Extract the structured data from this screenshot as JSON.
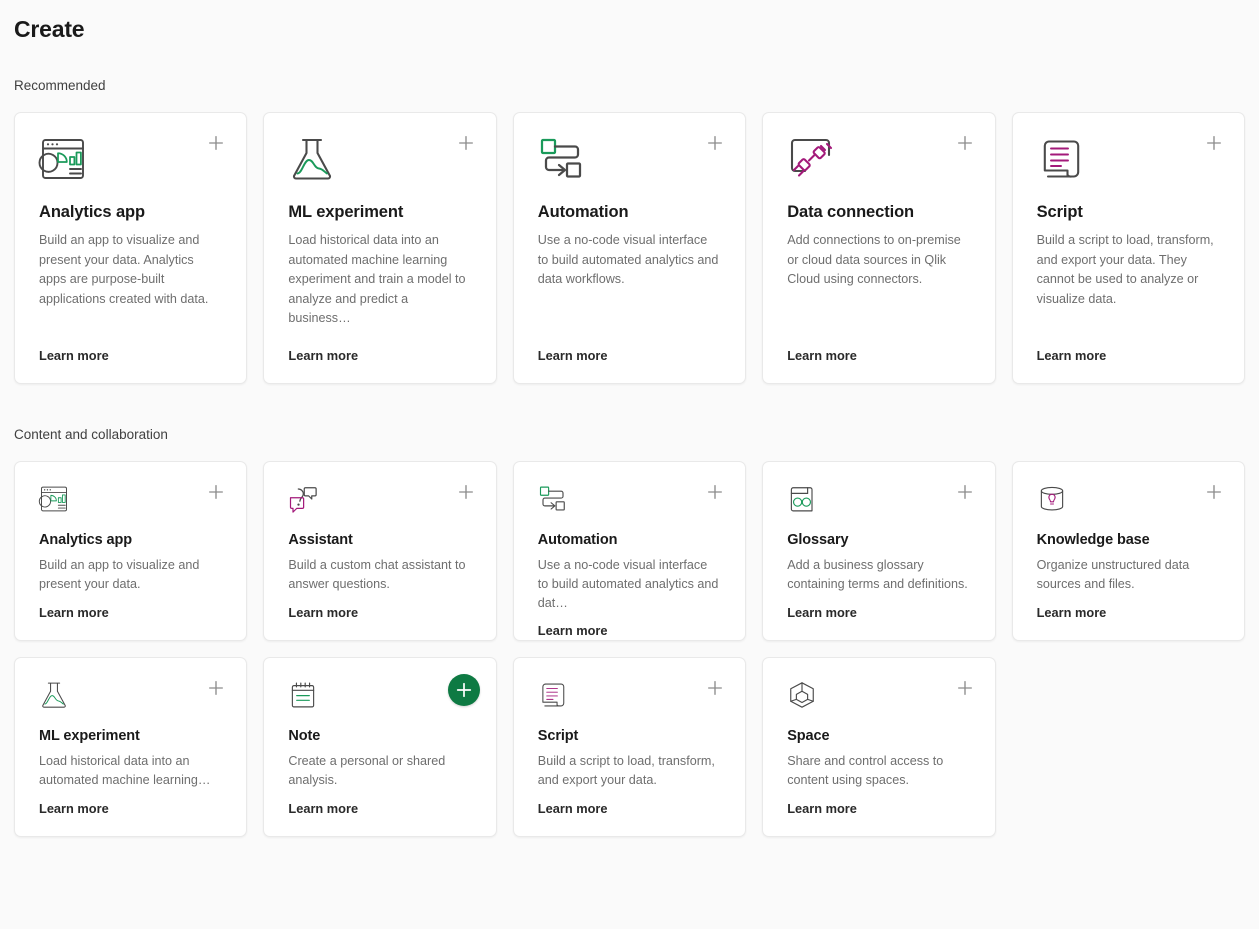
{
  "page": {
    "title": "Create"
  },
  "sections": [
    {
      "id": "recommended",
      "title": "Recommended",
      "cards": [
        {
          "icon": "analytics-app-icon",
          "title": "Analytics app",
          "description": "Build an app to visualize and present your data. Analytics apps are purpose-built applications created with data.",
          "link": "Learn more",
          "add_label": "+",
          "highlighted": false
        },
        {
          "icon": "ml-experiment-flask-icon",
          "title": "ML experiment",
          "description": "Load historical data into an automated machine learning experiment and train a model to analyze and predict a business…",
          "link": "Learn more",
          "add_label": "+",
          "highlighted": false
        },
        {
          "icon": "automation-flow-icon",
          "title": "Automation",
          "description": "Use a no-code visual interface to build automated analytics and data workflows.",
          "link": "Learn more",
          "add_label": "+",
          "highlighted": false
        },
        {
          "icon": "data-connection-plug-icon",
          "title": "Data connection",
          "description": "Add connections to on-premise or cloud data sources in Qlik Cloud using connectors.",
          "link": "Learn more",
          "add_label": "+",
          "highlighted": false
        },
        {
          "icon": "script-scroll-icon",
          "title": "Script",
          "description": "Build a script to load, transform, and export your data. They cannot be used to analyze or visualize data.",
          "link": "Learn more",
          "add_label": "+",
          "highlighted": false
        }
      ]
    },
    {
      "id": "content-and-collaboration",
      "title": "Content and collaboration",
      "cards_row1": [
        {
          "icon": "analytics-app-icon",
          "title": "Analytics app",
          "description": "Build an app to visualize and present your data.",
          "link": "Learn more",
          "add_label": "+",
          "highlighted": false
        },
        {
          "icon": "assistant-chat-icon",
          "title": "Assistant",
          "description": "Build a custom chat assistant to answer questions.",
          "link": "Learn more",
          "add_label": "+",
          "highlighted": false
        },
        {
          "icon": "automation-flow-icon",
          "title": "Automation",
          "description": "Use a no-code visual interface to build automated analytics and dat…",
          "link": "Learn more",
          "add_label": "+",
          "highlighted": false
        },
        {
          "icon": "glossary-book-icon",
          "title": "Glossary",
          "description": "Add a business glossary containing terms and definitions.",
          "link": "Learn more",
          "add_label": "+",
          "highlighted": false
        },
        {
          "icon": "knowledge-base-icon",
          "title": "Knowledge base",
          "description": "Organize unstructured data sources and files.",
          "link": "Learn more",
          "add_label": "+",
          "highlighted": false
        }
      ],
      "cards_row2": [
        {
          "icon": "ml-experiment-flask-icon",
          "title": "ML experiment",
          "description": "Load historical data into an automated machine learning…",
          "link": "Learn more",
          "add_label": "+",
          "highlighted": false
        },
        {
          "icon": "note-icon",
          "title": "Note",
          "description": "Create a personal or shared analysis.",
          "link": "Learn more",
          "add_label": "+",
          "highlighted": true
        },
        {
          "icon": "script-scroll-icon",
          "title": "Script",
          "description": "Build a script to load, transform, and export your data.",
          "link": "Learn more",
          "add_label": "+",
          "highlighted": false
        },
        {
          "icon": "space-cube-icon",
          "title": "Space",
          "description": "Share and control access to content using spaces.",
          "link": "Learn more",
          "add_label": "+",
          "highlighted": false
        }
      ]
    }
  ],
  "colors": {
    "page_background": "#fafafa",
    "card_background": "#ffffff",
    "accent_green": "#0e7a43",
    "focus_ring_pink": "#dc0a4e",
    "icon_green": "#1a9a5a",
    "icon_magenta": "#a3197a",
    "icon_outline": "#4a4a4a",
    "title_text": "#1a1a1a",
    "body_text": "#6e6e6e"
  }
}
